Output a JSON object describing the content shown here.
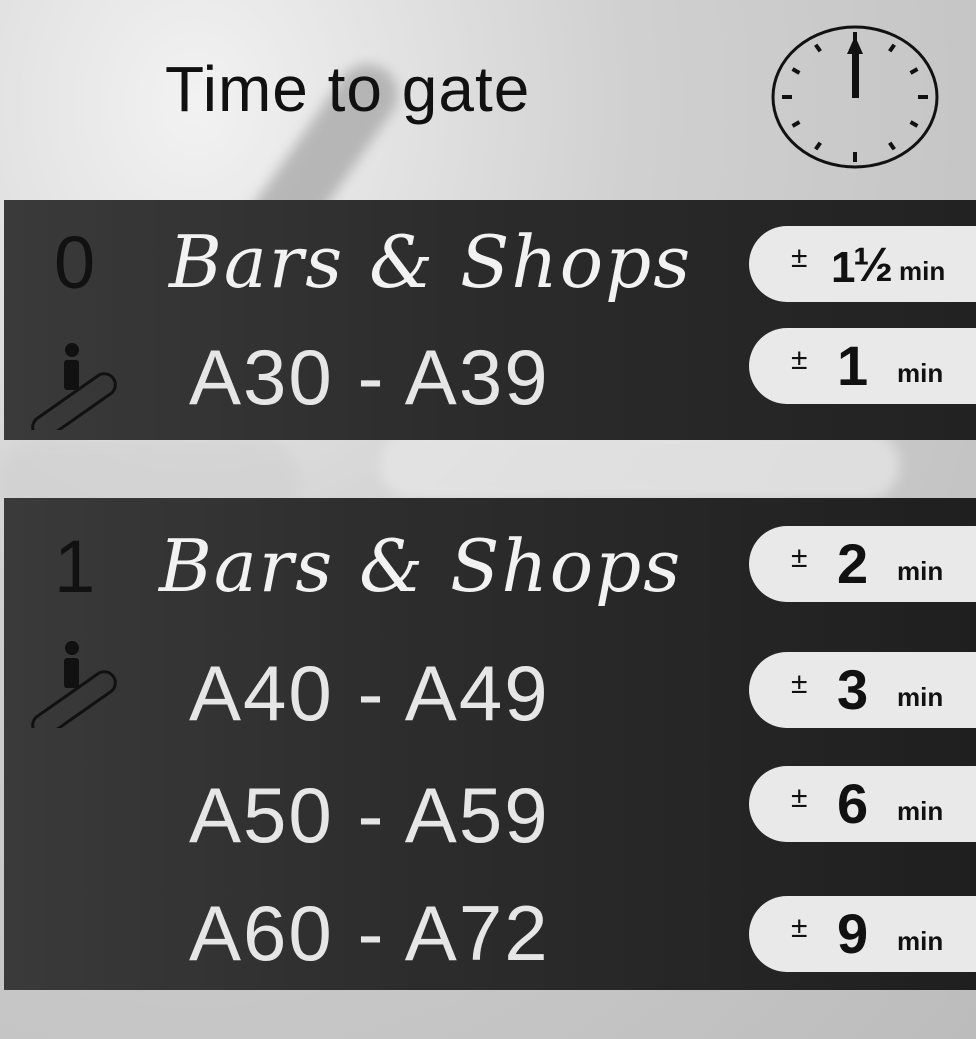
{
  "header": {
    "title": "Time to gate",
    "icon": "clock-icon"
  },
  "sections": [
    {
      "level": "0",
      "rows": [
        {
          "label": "Bars & Shops",
          "time_prefix": "±",
          "time_value": "½",
          "time_whole": "1",
          "unit": "min"
        },
        {
          "label": "A30 - A39",
          "time_prefix": "±",
          "time_value": "1",
          "unit": "min"
        }
      ]
    },
    {
      "level": "1",
      "rows": [
        {
          "label": "Bars & Shops",
          "time_prefix": "±",
          "time_value": "2",
          "unit": "min"
        },
        {
          "label": "A40 - A49",
          "time_prefix": "±",
          "time_value": "3",
          "unit": "min"
        },
        {
          "label": "A50 - A59",
          "time_prefix": "±",
          "time_value": "6",
          "unit": "min"
        },
        {
          "label": "A60 - A72",
          "time_prefix": "±",
          "time_value": "9",
          "unit": "min"
        }
      ]
    }
  ],
  "icons": {
    "escalator": "escalator-icon"
  }
}
